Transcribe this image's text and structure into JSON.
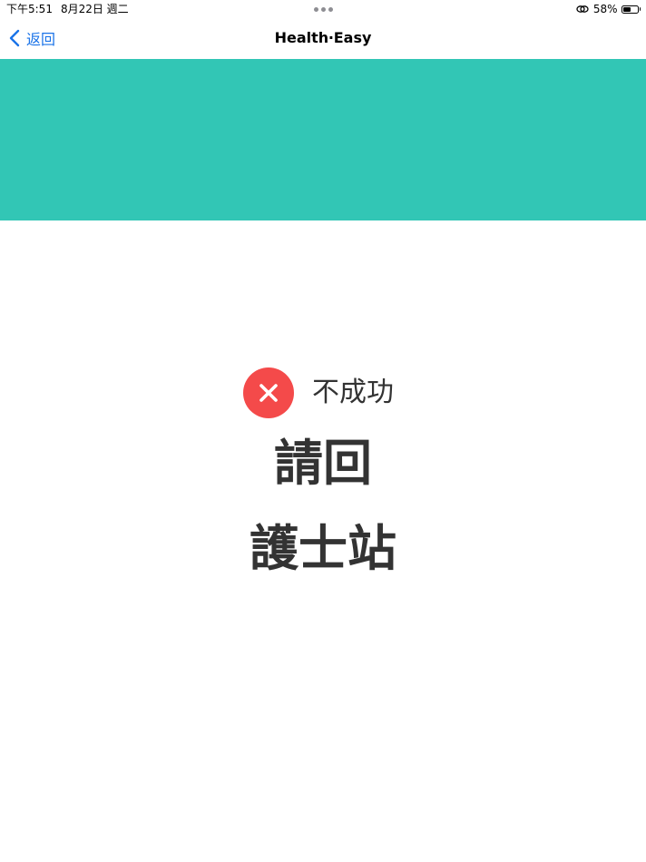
{
  "status_bar": {
    "time": "下午5:51",
    "date": "8月22日 週二",
    "battery": "58%",
    "battery_level": 0.58,
    "icons": [
      "link-icon",
      "battery-icon"
    ]
  },
  "nav": {
    "back_label": "返回",
    "title": "Health‧Easy",
    "icons": [
      "chevron-left-icon"
    ]
  },
  "banner": {
    "color": "#32c6b5"
  },
  "result": {
    "icon": "close-icon",
    "icon_color": "#f44a4a",
    "status_label": "不成功",
    "instruction_line_1": "請回",
    "instruction_line_2": "護士站"
  },
  "colors": {
    "accent": "#1a73e8",
    "text": "#333333"
  }
}
